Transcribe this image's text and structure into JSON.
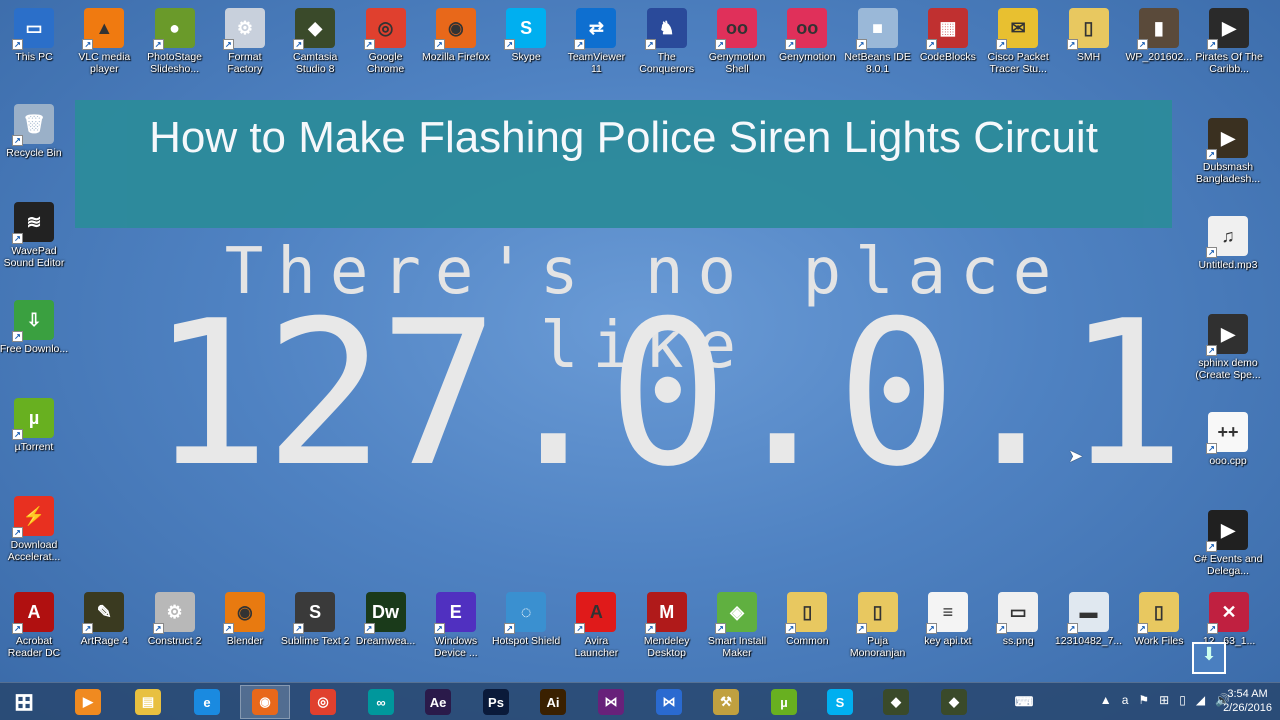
{
  "desktop": {
    "top_row": [
      {
        "label": "This PC",
        "color": "#2b6fc9",
        "glyph": "▭"
      },
      {
        "label": "VLC media player",
        "color": "#f07a10",
        "glyph": "▲"
      },
      {
        "label": "PhotoStage Slidesho...",
        "color": "#6a9a2a",
        "glyph": "●"
      },
      {
        "label": "Format Factory",
        "color": "#c8d0dc",
        "glyph": "⚙"
      },
      {
        "label": "Camtasia Studio 8",
        "color": "#3a4a2a",
        "glyph": "◆"
      },
      {
        "label": "Google Chrome",
        "color": "#e0402e",
        "glyph": "◎"
      },
      {
        "label": "Mozilla Firefox",
        "color": "#e8681a",
        "glyph": "◉"
      },
      {
        "label": "Skype",
        "color": "#00aff0",
        "glyph": "S"
      },
      {
        "label": "TeamViewer 11",
        "color": "#0e6fd0",
        "glyph": "⇄"
      },
      {
        "label": "The Conquerors",
        "color": "#2a4a9a",
        "glyph": "♞"
      },
      {
        "label": "Genymotion Shell",
        "color": "#e0305a",
        "glyph": "oo"
      },
      {
        "label": "Genymotion",
        "color": "#e0305a",
        "glyph": "oo"
      },
      {
        "label": "NetBeans IDE 8.0.1",
        "color": "#9ab8d8",
        "glyph": "■"
      },
      {
        "label": "CodeBlocks",
        "color": "#c03030",
        "glyph": "▦"
      },
      {
        "label": "Cisco Packet Tracer Stu...",
        "color": "#e8c030",
        "glyph": "✉"
      },
      {
        "label": "SMH",
        "color": "#e8c860",
        "glyph": "▯"
      },
      {
        "label": "WP_201602...",
        "color": "#5a4a3a",
        "glyph": "▮"
      },
      {
        "label": "Pirates Of The Caribb...",
        "color": "#2a2a2a",
        "glyph": "▶"
      }
    ],
    "left_col": [
      {
        "label": "Recycle Bin",
        "color": "#9ab0c8",
        "glyph": "🗑"
      },
      {
        "label": "WavePad Sound Editor",
        "color": "#222",
        "glyph": "≋"
      },
      {
        "label": "Free Downlo...",
        "color": "#3aa040",
        "glyph": "⇩"
      },
      {
        "label": "µTorrent",
        "color": "#68b020",
        "glyph": "µ"
      },
      {
        "label": "Download Accelerat...",
        "color": "#e83020",
        "glyph": "⚡"
      }
    ],
    "right_col": [
      {
        "label": "Dubsmash Bangladesh...",
        "color": "#3a3020",
        "glyph": "▶"
      },
      {
        "label": "Untitled.mp3",
        "color": "#f0f0f0",
        "glyph": "♫"
      },
      {
        "label": "sphinx demo (Create Spe...",
        "color": "#303030",
        "glyph": "▶"
      },
      {
        "label": "ooo.cpp",
        "color": "#f8f8f8",
        "glyph": "++"
      },
      {
        "label": "C# Events and Delega...",
        "color": "#202020",
        "glyph": "▶"
      }
    ],
    "bottom_row": [
      {
        "label": "Acrobat Reader DC",
        "color": "#b01010",
        "glyph": "A"
      },
      {
        "label": "ArtRage 4",
        "color": "#3a3a20",
        "glyph": "✎"
      },
      {
        "label": "Construct 2",
        "color": "#b8b8b8",
        "glyph": "⚙"
      },
      {
        "label": "Blender",
        "color": "#e87a10",
        "glyph": "◉"
      },
      {
        "label": "Sublime Text 2",
        "color": "#3a3a3a",
        "glyph": "S"
      },
      {
        "label": "Dreamwea...",
        "color": "#1a3a1a",
        "glyph": "Dw"
      },
      {
        "label": "Windows Device ...",
        "color": "#5030c0",
        "glyph": "E"
      },
      {
        "label": "Hotspot Shield",
        "color": "#3a90d0",
        "glyph": "◌"
      },
      {
        "label": "Avira Launcher",
        "color": "#e01a1a",
        "glyph": "A"
      },
      {
        "label": "Mendeley Desktop",
        "color": "#b01a1a",
        "glyph": "M"
      },
      {
        "label": "Smart Install Maker",
        "color": "#60b040",
        "glyph": "◈"
      },
      {
        "label": "Common",
        "color": "#e8c860",
        "glyph": "▯"
      },
      {
        "label": "Puja Monoranjan",
        "color": "#e8c860",
        "glyph": "▯"
      },
      {
        "label": "key api.txt",
        "color": "#f4f4f4",
        "glyph": "≡"
      },
      {
        "label": "ss.png",
        "color": "#f0f0f0",
        "glyph": "▭"
      },
      {
        "label": "12310482_7...",
        "color": "#e0e8f0",
        "glyph": "▬"
      },
      {
        "label": "Work Files",
        "color": "#e8c860",
        "glyph": "▯"
      },
      {
        "label": "12...63_1...",
        "color": "#c02040",
        "glyph": "✕"
      }
    ]
  },
  "banner": {
    "title": "How to Make Flashing Police Siren Lights Circuit"
  },
  "wallpaper": {
    "line1": "There's no place like",
    "line2": "127.0.0.1"
  },
  "taskbar": {
    "items": [
      {
        "name": "start",
        "color": "#ffffff",
        "glyph": "⊞"
      },
      {
        "name": "windows-media-player",
        "color": "#f08a20",
        "glyph": "▶"
      },
      {
        "name": "file-explorer",
        "color": "#e8c040",
        "glyph": "▤"
      },
      {
        "name": "internet-explorer",
        "color": "#1a8ae0",
        "glyph": "e"
      },
      {
        "name": "firefox",
        "color": "#e8681a",
        "glyph": "◉"
      },
      {
        "name": "chrome",
        "color": "#e0402e",
        "glyph": "◎"
      },
      {
        "name": "arduino",
        "color": "#00979c",
        "glyph": "∞"
      },
      {
        "name": "after-effects",
        "color": "#2a1a4a",
        "glyph": "Ae"
      },
      {
        "name": "photoshop",
        "color": "#0a1a3a",
        "glyph": "Ps"
      },
      {
        "name": "illustrator",
        "color": "#3a2000",
        "glyph": "Ai"
      },
      {
        "name": "visual-studio",
        "color": "#68217a",
        "glyph": "⋈"
      },
      {
        "name": "visual-studio-code",
        "color": "#2a6ad0",
        "glyph": "⋈"
      },
      {
        "name": "tools",
        "color": "#c0a040",
        "glyph": "⚒"
      },
      {
        "name": "utorrent",
        "color": "#68b020",
        "glyph": "µ"
      },
      {
        "name": "skype",
        "color": "#00aff0",
        "glyph": "S"
      },
      {
        "name": "camtasia",
        "color": "#3a4a2a",
        "glyph": "◆"
      },
      {
        "name": "camtasia-recorder",
        "color": "#3a4a2a",
        "glyph": "◆"
      },
      {
        "name": "touch-keyboard",
        "color": "#ffffff",
        "glyph": "⌨"
      }
    ],
    "active_index": 4,
    "tray": [
      "▲",
      "a",
      "⚑",
      "⊞",
      "▯",
      "◢",
      "🔊"
    ],
    "time": "3:54 AM",
    "date": "2/26/2016"
  }
}
